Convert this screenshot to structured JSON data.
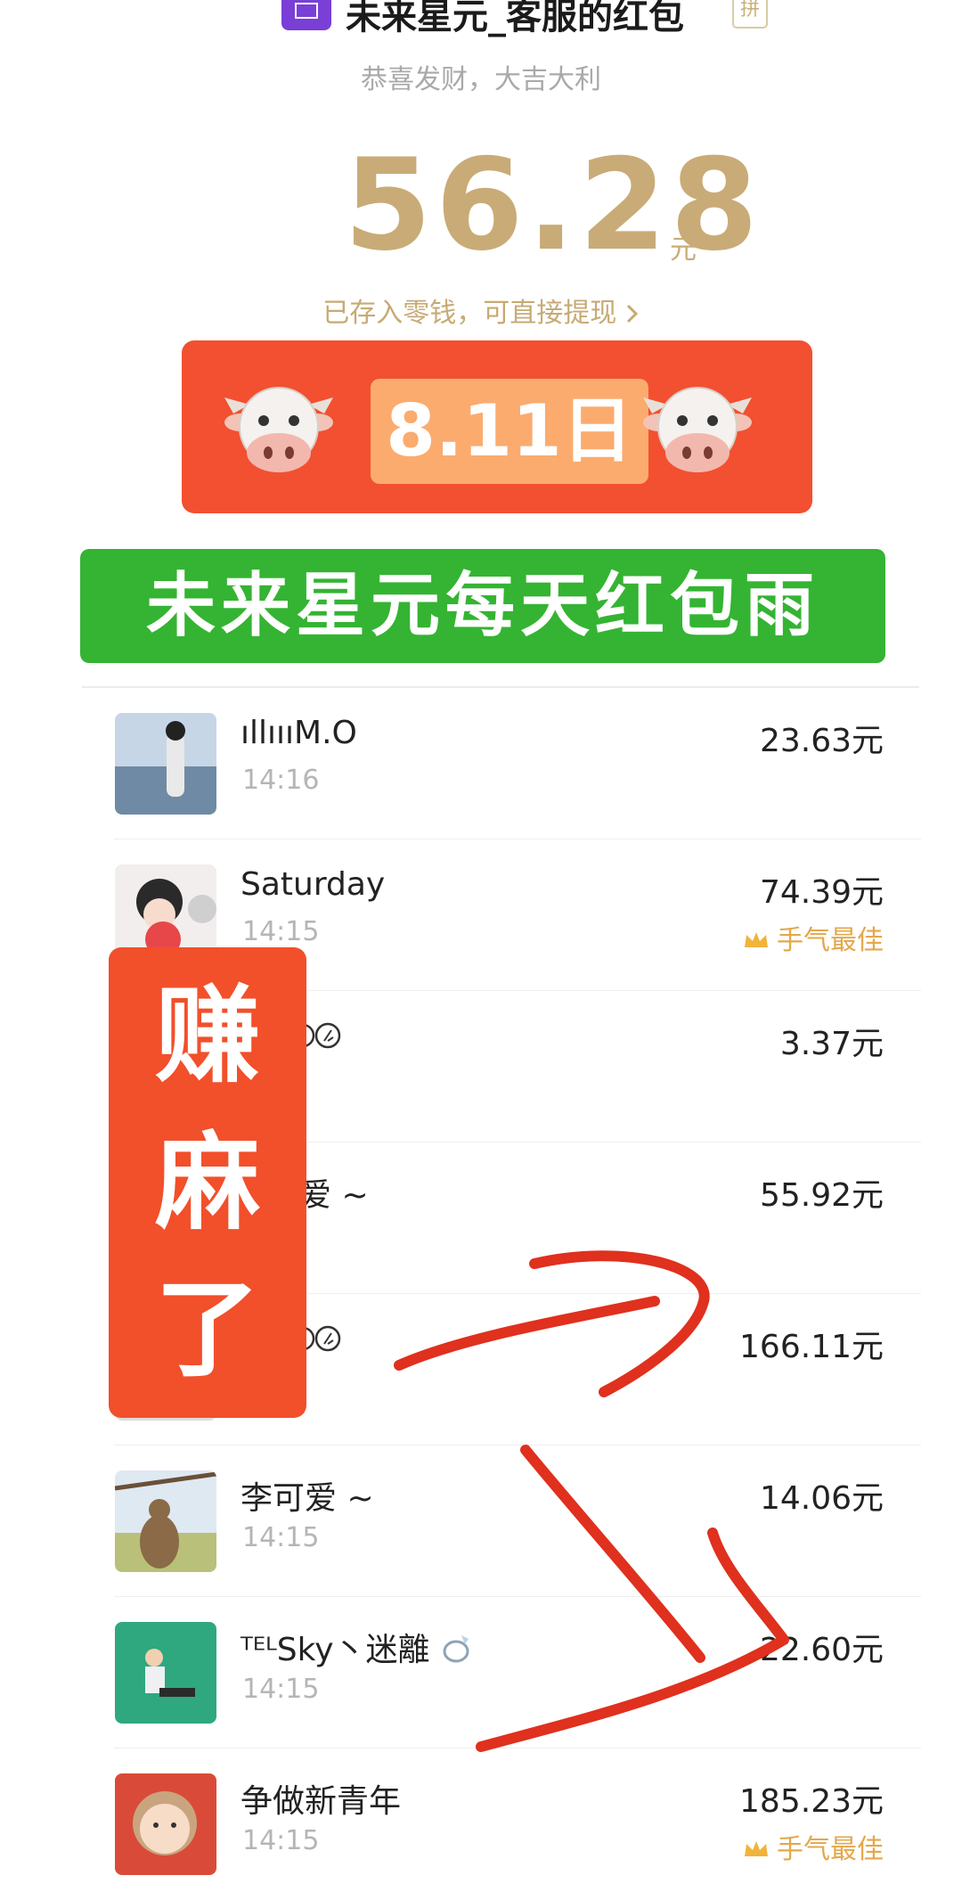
{
  "header": {
    "sender_name": "未来星元_客服的红包",
    "pin_badge": "拼",
    "wishes": "恭喜发财，大吉大利",
    "amount": "56.28",
    "amount_unit": "元",
    "saved_link": "已存入零钱，可直接提现"
  },
  "overlays": {
    "date": "8.11日",
    "cow_emoji": "cow-face",
    "green_banner": "未来星元每天红包雨",
    "red_chars": [
      "赚",
      "麻",
      "了"
    ]
  },
  "list": [
    {
      "name": "ıllıııM.O",
      "time": "14:16",
      "amount": "23.63元",
      "best": ""
    },
    {
      "name": "Saturday",
      "time": "14:15",
      "amount": "74.39元",
      "best": "手气最佳"
    },
    {
      "name": "",
      "time": "",
      "amount": "3.37元",
      "best": ""
    },
    {
      "name": "",
      "time": "",
      "amount": "55.92元",
      "best": ""
    },
    {
      "name": "",
      "time": "",
      "amount": "166.11元",
      "best": ""
    },
    {
      "name": "李可爱 ~",
      "time": "14:15",
      "amount": "14.06元",
      "best": ""
    },
    {
      "name": "ᵀᴱᴸSky丶迷離",
      "time": "14:15",
      "amount": "22.60元",
      "best": ""
    },
    {
      "name": "争做新青年",
      "time": "14:15",
      "amount": "185.23元",
      "best": "手气最佳"
    }
  ],
  "colors": {
    "gold": "#c9ab77",
    "red_banner": "#f25030",
    "green_banner": "#34b432",
    "best_orange": "#e3a84a"
  }
}
